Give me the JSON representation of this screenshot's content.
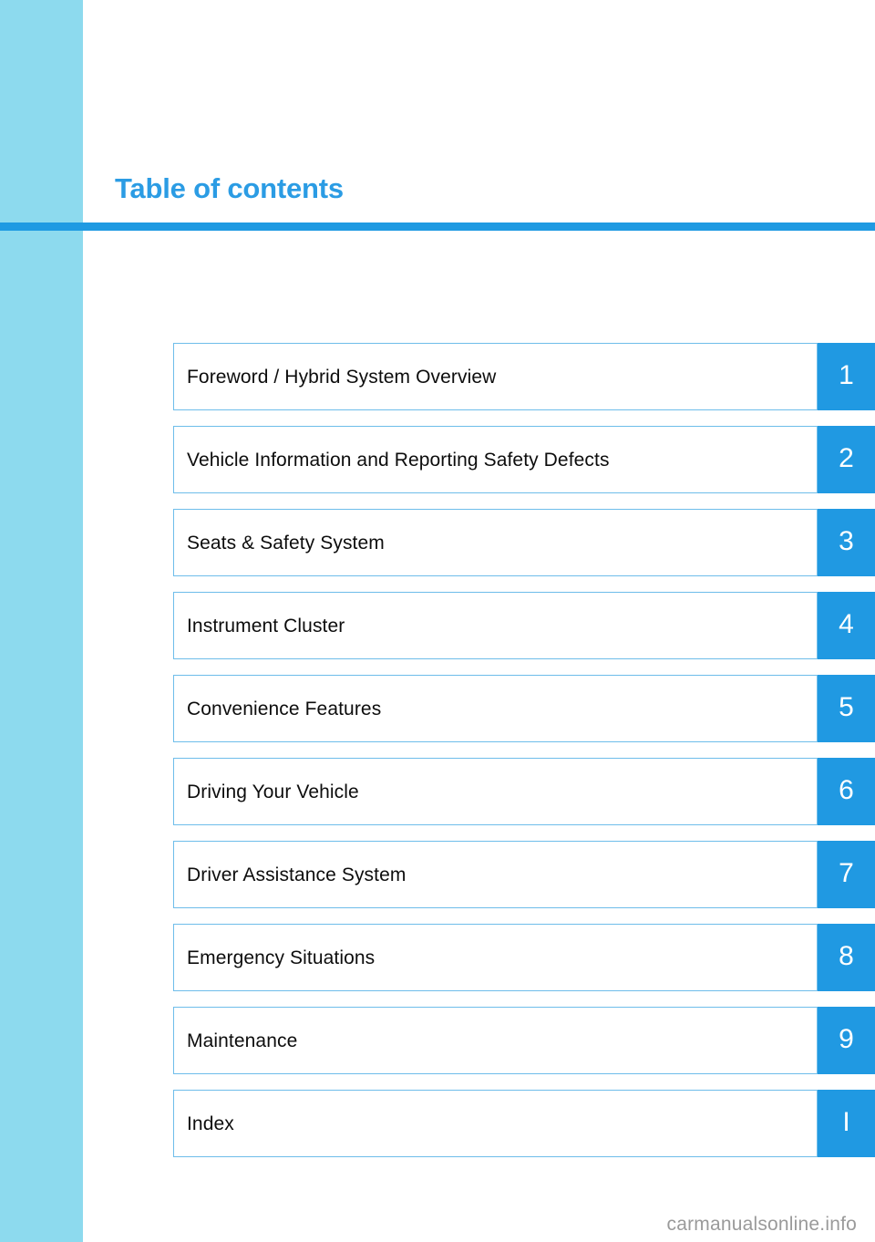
{
  "page": {
    "title": "Table of contents",
    "watermark": "carmanualsonline.info",
    "colors": {
      "side_strip": "#8ddaee",
      "accent": "#2099e2",
      "rule": "#1f9ae2",
      "title_text": "#2b9ce4",
      "plate_border": "#6ebdea",
      "label_text": "#0d0d0d",
      "tab_text": "#ffffff",
      "watermark_text": "#9a9a9a"
    }
  },
  "contents": {
    "rows": [
      {
        "label": "Foreword / Hybrid System Overview",
        "tab": "1"
      },
      {
        "label": "Vehicle Information and Reporting Safety Defects",
        "tab": "2"
      },
      {
        "label": "Seats & Safety System",
        "tab": "3"
      },
      {
        "label": "Instrument Cluster",
        "tab": "4"
      },
      {
        "label": "Convenience Features",
        "tab": "5"
      },
      {
        "label": "Driving Your Vehicle",
        "tab": "6"
      },
      {
        "label": "Driver Assistance System",
        "tab": "7"
      },
      {
        "label": "Emergency Situations",
        "tab": "8"
      },
      {
        "label": "Maintenance",
        "tab": "9"
      },
      {
        "label": "Index",
        "tab": "I"
      }
    ]
  }
}
